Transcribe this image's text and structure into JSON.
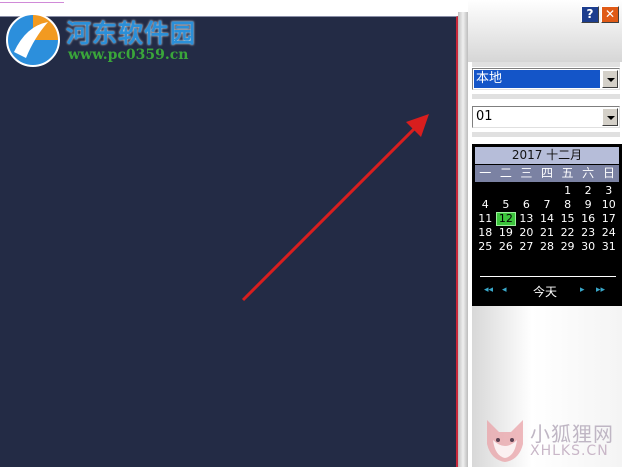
{
  "watermark_top": {
    "title": "河东软件园",
    "url": "www.pc0359.cn"
  },
  "watermark_bottom": {
    "title": "小狐狸网",
    "url": "XHLKS.CN"
  },
  "titlebar": {
    "help_label": "?",
    "close_label": "✕"
  },
  "source_select": {
    "value": "本地"
  },
  "channel_select": {
    "value": "01"
  },
  "calendar": {
    "header": "2017 十二月",
    "weekdays": [
      "一",
      "二",
      "三",
      "四",
      "五",
      "六",
      "日"
    ],
    "days": [
      "",
      "",
      "",
      "",
      "1",
      "2",
      "3",
      "4",
      "5",
      "6",
      "7",
      "8",
      "9",
      "10",
      "11",
      "12",
      "13",
      "14",
      "15",
      "16",
      "17",
      "18",
      "19",
      "20",
      "21",
      "22",
      "23",
      "24",
      "25",
      "26",
      "27",
      "28",
      "29",
      "30",
      "31"
    ],
    "selected_day": "12",
    "nav": {
      "prev_year": "◂◂",
      "prev_month": "◂",
      "next_month": "▸",
      "next_year": "▸▸"
    },
    "today_label": "今天"
  },
  "colors": {
    "video_bg": "#232b45",
    "arrow": "#d81e1e",
    "selected_source": "#1455c8",
    "today_cell": "#3cc53c"
  }
}
